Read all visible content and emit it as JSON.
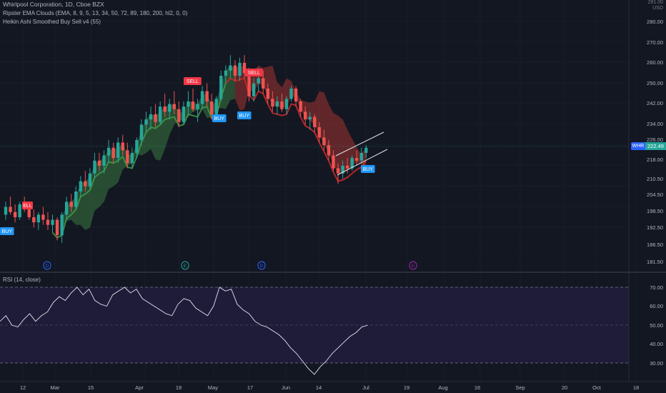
{
  "legend": {
    "title": "Whirlpool Corporation, 1D, Cboe BZX",
    "indicator1": "Ripster EMA Clouds (EMA, 8, 9, 5, 13, 34, 50, 72, 89, 180, 200, hl2, 0, 0)",
    "indicator2": "Heikin Ashi Smoothed Buy Sell v4  (55)"
  },
  "rsi_legend": "RSI (14, close)",
  "axis": {
    "currency": "USD",
    "top_label": "291.00",
    "price_ticks": [
      "280.00",
      "270.00",
      "260.00",
      "250.00",
      "242.00",
      "234.00",
      "226.00",
      "218.00",
      "210.50",
      "204.50",
      "198.50",
      "192.50",
      "186.50",
      "181.50"
    ],
    "rsi_ticks": [
      "70.00",
      "60.00",
      "50.00",
      "40.00",
      "30.00"
    ],
    "time_ticks": [
      "12",
      "Mar",
      "15",
      "Apr",
      "19",
      "May",
      "17",
      "Jun",
      "14",
      "Jul",
      "19",
      "Aug",
      "16",
      "Sep",
      "20",
      "Oct",
      "18"
    ]
  },
  "ticker": {
    "symbol": "WHR",
    "price": "222.49"
  },
  "signals": [
    "SELL",
    "SELL",
    "BUY",
    "BUY",
    "BUY",
    "BUY"
  ],
  "signal_partial": "ELL",
  "events": [
    "D",
    "E",
    "D",
    "E"
  ],
  "colors": {
    "bg": "#131722",
    "up": "#26a69a",
    "down": "#ef5350",
    "buy": "#2196f3",
    "sell": "#f23645",
    "rsi_band": "#1f1c3a",
    "event_div": "#2962ff",
    "event_earn": "#9c27b0"
  },
  "chart_data": {
    "type": "candlestick",
    "title": "Whirlpool Corporation, 1D, Cboe BZX",
    "ylim": [
      180,
      285
    ],
    "candles": [
      [
        0,
        196,
        201,
        194,
        199
      ],
      [
        1,
        199,
        203,
        196,
        197
      ],
      [
        2,
        197,
        200,
        193,
        195
      ],
      [
        3,
        195,
        201,
        194,
        200
      ],
      [
        4,
        200,
        203,
        197,
        198
      ],
      [
        5,
        198,
        200,
        194,
        195
      ],
      [
        6,
        195,
        198,
        191,
        193
      ],
      [
        7,
        193,
        197,
        190,
        196
      ],
      [
        8,
        196,
        199,
        192,
        194
      ],
      [
        9,
        194,
        197,
        190,
        192
      ],
      [
        10,
        192,
        196,
        189,
        194
      ],
      [
        11,
        194,
        195,
        186,
        188
      ],
      [
        12,
        188,
        197,
        185,
        196
      ],
      [
        13,
        196,
        203,
        194,
        201
      ],
      [
        14,
        201,
        204,
        197,
        199
      ],
      [
        15,
        199,
        207,
        198,
        205
      ],
      [
        16,
        205,
        211,
        203,
        209
      ],
      [
        17,
        209,
        213,
        205,
        207
      ],
      [
        18,
        207,
        214,
        206,
        212
      ],
      [
        19,
        212,
        220,
        210,
        217
      ],
      [
        20,
        217,
        220,
        213,
        215
      ],
      [
        21,
        215,
        221,
        212,
        219
      ],
      [
        22,
        219,
        225,
        216,
        222
      ],
      [
        23,
        222,
        224,
        216,
        218
      ],
      [
        24,
        218,
        226,
        216,
        224
      ],
      [
        25,
        224,
        227,
        219,
        221
      ],
      [
        26,
        221,
        224,
        214,
        216
      ],
      [
        27,
        216,
        222,
        214,
        220
      ],
      [
        28,
        220,
        226,
        218,
        225
      ],
      [
        29,
        225,
        233,
        223,
        231
      ],
      [
        30,
        231,
        236,
        228,
        233
      ],
      [
        31,
        233,
        238,
        229,
        235
      ],
      [
        32,
        235,
        239,
        230,
        232
      ],
      [
        33,
        232,
        240,
        231,
        238
      ],
      [
        34,
        238,
        243,
        234,
        236
      ],
      [
        35,
        236,
        241,
        233,
        239
      ],
      [
        36,
        239,
        244,
        235,
        237
      ],
      [
        37,
        237,
        240,
        230,
        232
      ],
      [
        38,
        232,
        240,
        231,
        238
      ],
      [
        39,
        238,
        244,
        235,
        240
      ],
      [
        40,
        240,
        245,
        236,
        237
      ],
      [
        41,
        237,
        241,
        232,
        239
      ],
      [
        42,
        239,
        246,
        237,
        244
      ],
      [
        43,
        244,
        247,
        238,
        240
      ],
      [
        44,
        240,
        243,
        233,
        235
      ],
      [
        45,
        235,
        242,
        234,
        241
      ],
      [
        46,
        241,
        252,
        240,
        250
      ],
      [
        47,
        250,
        254,
        247,
        252
      ],
      [
        48,
        252,
        258,
        249,
        254
      ],
      [
        49,
        254,
        256,
        248,
        250
      ],
      [
        50,
        250,
        257,
        248,
        255
      ],
      [
        51,
        255,
        258,
        249,
        251
      ],
      [
        52,
        251,
        253,
        240,
        242
      ],
      [
        53,
        242,
        249,
        240,
        247
      ],
      [
        54,
        247,
        253,
        244,
        249
      ],
      [
        55,
        249,
        252,
        243,
        245
      ],
      [
        56,
        245,
        247,
        239,
        241
      ],
      [
        57,
        241,
        244,
        236,
        238
      ],
      [
        58,
        238,
        242,
        235,
        240
      ],
      [
        59,
        240,
        243,
        236,
        237
      ],
      [
        60,
        237,
        242,
        235,
        241
      ],
      [
        61,
        241,
        246,
        240,
        245
      ],
      [
        62,
        245,
        246,
        238,
        240
      ],
      [
        63,
        240,
        241,
        234,
        236
      ],
      [
        64,
        236,
        238,
        231,
        233
      ],
      [
        65,
        233,
        236,
        229,
        234
      ],
      [
        66,
        234,
        235,
        228,
        230
      ],
      [
        67,
        230,
        232,
        224,
        226
      ],
      [
        68,
        226,
        229,
        221,
        223
      ],
      [
        69,
        223,
        225,
        217,
        219
      ],
      [
        70,
        219,
        221,
        213,
        214
      ],
      [
        71,
        214,
        216,
        208,
        212
      ],
      [
        72,
        212,
        217,
        210,
        215
      ],
      [
        73,
        215,
        218,
        212,
        214
      ],
      [
        74,
        214,
        219,
        213,
        218
      ],
      [
        75,
        218,
        221,
        215,
        217
      ],
      [
        76,
        217,
        222,
        216,
        220
      ],
      [
        77,
        220,
        223,
        218,
        222
      ]
    ],
    "rsi": [
      52,
      55,
      50,
      49,
      53,
      56,
      52,
      55,
      57,
      62,
      65,
      63,
      67,
      70,
      66,
      69,
      63,
      61,
      60,
      66,
      68,
      70,
      67,
      69,
      64,
      62,
      60,
      58,
      56,
      55,
      61,
      64,
      63,
      59,
      57,
      55,
      60,
      70,
      68,
      69,
      61,
      58,
      56,
      52,
      50,
      49,
      47,
      45,
      42,
      38,
      35,
      31,
      27,
      24,
      28,
      31,
      35,
      38,
      41,
      44,
      46,
      49,
      50
    ],
    "rsi_ylim": [
      25,
      75
    ]
  }
}
